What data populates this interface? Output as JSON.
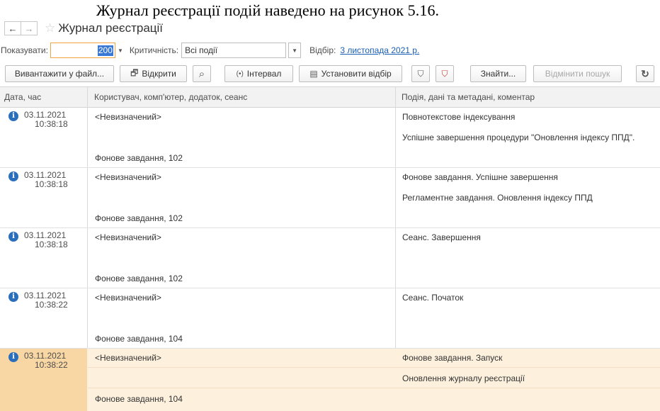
{
  "caption": "Журнал реєстрації подій наведено на рисунок 5.16.",
  "window": {
    "back_icon": "←",
    "forward_icon": "→",
    "star_icon": "☆",
    "title": "Журнал реєстрації"
  },
  "filter": {
    "show_label": "Показувати:",
    "show_value": "200",
    "dropdown_icon": "▼",
    "criticality_label": "Критичність:",
    "criticality_value": "Всі події",
    "selection_label": "Відбір:",
    "selection_link": "3 листопада 2021 р."
  },
  "toolbar": {
    "export": "Вивантажити у файл...",
    "open": "Відкрити",
    "interval": "Інтервал",
    "set_filter": "Установити відбір",
    "find": "Знайти...",
    "cancel_search": "Відмінити пошук",
    "icons": {
      "open": "🗗",
      "search": "⌕",
      "interval": "(•)",
      "set_filter": "▤",
      "funnel": "⛉",
      "funnel_clear": "⛉",
      "refresh": "↻"
    }
  },
  "table": {
    "columns": [
      "Дата, час",
      "Користувач, комп'ютер, додаток, сеанс",
      "Подія, дані та метадані, коментар"
    ],
    "info_icon": "i",
    "rows": [
      {
        "date": "03.11.2021",
        "time": "10:38:18",
        "user": "<Невизначений>",
        "session": "Фонове завдання, 102",
        "event": "Повнотекстове індексування",
        "detail": "Успішне завершення процедури \"Оновлення індексу ППД\"."
      },
      {
        "date": "03.11.2021",
        "time": "10:38:18",
        "user": "<Невизначений>",
        "session": "Фонове завдання, 102",
        "event": "Фонове завдання. Успішне завершення",
        "detail": "Регламентне завдання. Оновлення індексу ППД"
      },
      {
        "date": "03.11.2021",
        "time": "10:38:18",
        "user": "<Невизначений>",
        "session": "Фонове завдання, 102",
        "event": "Сеанс. Завершення",
        "detail": ""
      },
      {
        "date": "03.11.2021",
        "time": "10:38:22",
        "user": "<Невизначений>",
        "session": "Фонове завдання, 104",
        "event": "Сеанс. Початок",
        "detail": ""
      },
      {
        "date": "03.11.2021",
        "time": "10:38:22",
        "user": "<Невизначений>",
        "session": "Фонове завдання, 104",
        "event": "Фонове завдання. Запуск",
        "detail": "Оновлення журналу реєстрації"
      }
    ]
  }
}
